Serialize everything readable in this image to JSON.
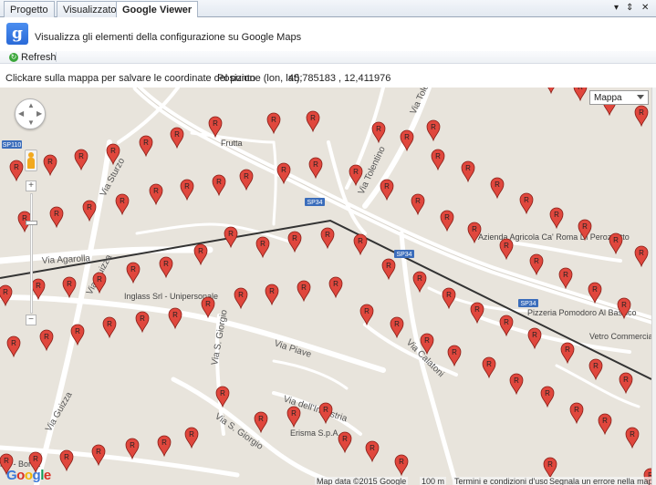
{
  "tabs": [
    {
      "label": "Progetto",
      "active": false
    },
    {
      "label": "Visualizzatore",
      "active": false
    },
    {
      "label": "Google Viewer",
      "active": true
    }
  ],
  "header": {
    "logo_icon": "google-g-icon",
    "text": "Visualizza gli elementi della configurazione su Google Maps"
  },
  "toolbar": {
    "refresh_label": "Refresh",
    "refresh_icon": "refresh-icon"
  },
  "info": {
    "hint": "Clickare sulla mappa per salvare le coordinate del punto",
    "position_label": "Posizione (lon, lat):",
    "position_value": "45,785183 , 12,411976"
  },
  "map": {
    "map_type": "Mappa",
    "street_labels": [
      "Via Agarolla",
      "Via Guizza",
      "Via Sturzo",
      "Via Tolentino",
      "Via Tolent",
      "Via Piave",
      "Via S. Giorgio",
      "Via Calatoni",
      "Via dell'Industria",
      "Via Guizza",
      "Via S. Giorgio"
    ],
    "road_shields": [
      "SP110",
      "SP34",
      "SP34",
      "SP34"
    ],
    "places": [
      "Inglass Srl - Unipersonale",
      "Azienda Agricola Ca' Roma Di Perozzetto",
      "Pizzeria Pomodoro Al Basilico",
      "Vetro Commerciale",
      "Erisma S.p.A.",
      "Frutta",
      "ndi - Bortot"
    ],
    "attribution": {
      "data": "Map data ©2015 Google",
      "scale": "100 m",
      "terms": "Termini e condizioni d'uso",
      "report": "Segnala un errore nella mappa"
    },
    "marker_label": "R",
    "colors": {
      "background": "#e8e4dc",
      "road": "#ffffff",
      "boundary": "#333333",
      "marker": "#e0473d",
      "shield": "#3b6dbb"
    }
  }
}
